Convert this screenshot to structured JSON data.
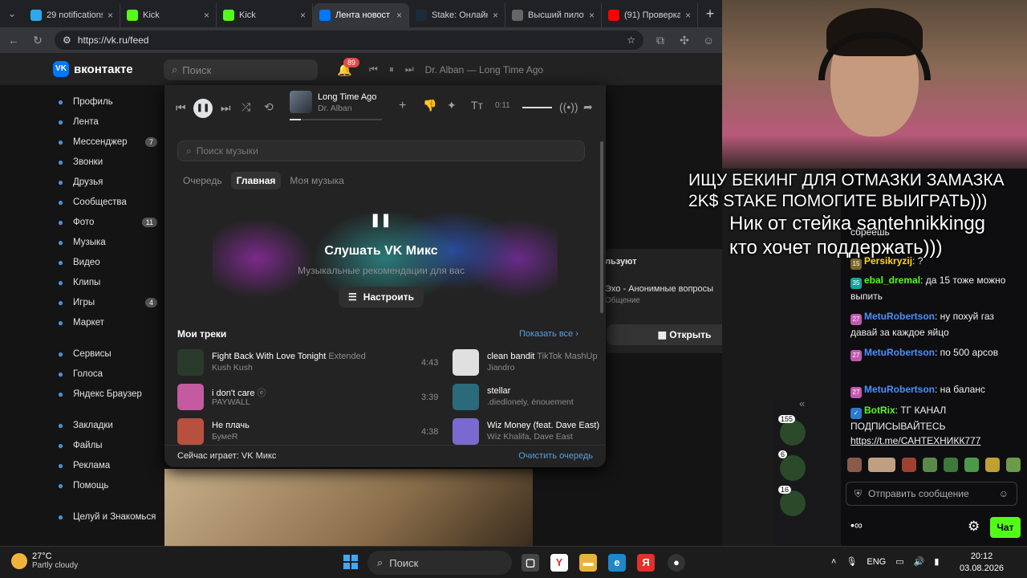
{
  "browser": {
    "tabs": [
      {
        "title": "29 notifications",
        "icon": "telegram-icon",
        "color": "#2aabee"
      },
      {
        "title": "Kick",
        "icon": "kick-icon",
        "color": "#53fc18"
      },
      {
        "title": "Kick",
        "icon": "kick-icon",
        "color": "#53fc18"
      },
      {
        "title": "Лента новост",
        "icon": "vk-video-icon",
        "color": "#0077ff"
      },
      {
        "title": "Stake: Онлайн-к",
        "icon": "stake-icon",
        "color": "#1a2c38"
      },
      {
        "title": "Высший пилота",
        "icon": "globe-icon",
        "color": "#666666"
      },
      {
        "title": "(91) Проверка",
        "icon": "youtube-icon",
        "color": "#ff0000"
      }
    ],
    "url": "https://vk.ru/feed"
  },
  "vk": {
    "brand": "вконтакте",
    "search_placeholder": "Поиск",
    "notifications_count": "89",
    "mini_player_track": "Dr. Alban — Long Time Ago",
    "sidebar": [
      {
        "label": "Профиль",
        "icon": "profile-icon",
        "badge": ""
      },
      {
        "label": "Лента",
        "icon": "feed-icon",
        "badge": ""
      },
      {
        "label": "Мессенджер",
        "icon": "messenger-icon",
        "badge": "7"
      },
      {
        "label": "Звонки",
        "icon": "phone-icon",
        "badge": ""
      },
      {
        "label": "Друзья",
        "icon": "friends-icon",
        "badge": ""
      },
      {
        "label": "Сообщества",
        "icon": "communities-icon",
        "badge": ""
      },
      {
        "label": "Фото",
        "icon": "photo-icon",
        "badge": "11"
      },
      {
        "label": "Музыка",
        "icon": "music-icon",
        "badge": ""
      },
      {
        "label": "Видео",
        "icon": "video-icon",
        "badge": ""
      },
      {
        "label": "Клипы",
        "icon": "clips-icon",
        "badge": ""
      },
      {
        "label": "Игры",
        "icon": "games-icon",
        "badge": "4"
      },
      {
        "label": "Маркет",
        "icon": "market-icon",
        "badge": ""
      }
    ],
    "sidebar2": [
      {
        "label": "Сервисы",
        "icon": "services-icon"
      },
      {
        "label": "Голоса",
        "icon": "votes-icon"
      },
      {
        "label": "Яндекс Браузер",
        "icon": "yandex-icon"
      }
    ],
    "sidebar3": [
      {
        "label": "Закладки",
        "icon": "bookmark-icon"
      },
      {
        "label": "Файлы",
        "icon": "files-icon"
      },
      {
        "label": "Реклама",
        "icon": "ads-icon"
      },
      {
        "label": "Помощь",
        "icon": "help-icon"
      }
    ],
    "sidebar4": [
      {
        "label": "Целуй и Знакомься",
        "icon": "app-icon"
      }
    ],
    "right_panel": {
      "heading": "льзуют",
      "app_name": "Эхо - Анонимные вопросы",
      "app_sub": "Общение",
      "open_label": "Открыть"
    }
  },
  "player": {
    "track_title": "Long Time Ago",
    "track_artist": "Dr. Alban",
    "time": "0:11",
    "progress": 0.12,
    "search_placeholder": "Поиск музыки",
    "tabs": [
      "Очередь",
      "Главная",
      "Моя музыка"
    ],
    "active_tab": 1,
    "mix_title": "Слушать VK Микс",
    "mix_subtitle": "Музыкальные рекомендации для вас",
    "tune_label": "Настроить",
    "my_tracks_title": "Мои треки",
    "show_all": "Показать все",
    "tracks_left": [
      {
        "title": "Fight Back With Love Tonight",
        "extra": "Extended",
        "artist": "Kush Kush",
        "duration": "4:43",
        "color": "#2a3a2a"
      },
      {
        "title": "i don't care",
        "extra": "ⓔ",
        "artist": "PAYWALL",
        "duration": "3:39",
        "color": "#c45aa0"
      },
      {
        "title": "Не плачь",
        "extra": "",
        "artist": "БумеR",
        "duration": "4:38",
        "color": "#b85040"
      }
    ],
    "tracks_right": [
      {
        "title": "clean bandit",
        "extra": "TikTok MashUp",
        "artist": "Jiandro",
        "color": "#e0e0e0"
      },
      {
        "title": "stellar",
        "extra": "",
        "artist": ".diedlonely, énouement",
        "color": "#2a6a7a"
      },
      {
        "title": "Wiz Money (feat. Dave East)",
        "extra": "",
        "artist": "Wiz Khalifa, Dave East",
        "color": "#7a6ad0"
      }
    ],
    "now_playing": "Сейчас играет: VK Микс",
    "clear_queue": "Очистить очередь"
  },
  "stream": {
    "overlay_lines": [
      "ИЩУ БЕКИНГ ДЛЯ ОТМАЗКИ ЗАМАЗКА",
      "2K$ STAKE ПОМОГИТЕ ВЫИГРАТЬ)))",
      "Ник от стейка santehnikkingg",
      "кто хочет поддержать)))"
    ],
    "chat": [
      {
        "badge": "",
        "user": "",
        "text": "сбреешь",
        "ucolor": "#efeff1",
        "bcolor": "#444"
      },
      {
        "badge": "15",
        "user": "Persikryzij",
        "text": "?",
        "ucolor": "#ffd700",
        "bcolor": "#7a6a2a"
      },
      {
        "badge": "35",
        "user": "ebal_dremal",
        "text": "да 15 тоже можно выпить",
        "ucolor": "#53fc18",
        "bcolor": "#1aa19a"
      },
      {
        "badge": "27",
        "user": "MetuRobertson",
        "text": "ну похуй газ давай за каждое яйцо",
        "ucolor": "#4a8fff",
        "bcolor": "#c05ab0"
      },
      {
        "badge": "27",
        "user": "MetuRobertson",
        "text": "по 500 арсов",
        "ucolor": "#4a8fff",
        "bcolor": "#c05ab0"
      },
      {
        "badge": "27",
        "user": "MetuRobertson",
        "text": "на баланс",
        "ucolor": "#4a8fff",
        "bcolor": "#c05ab0"
      },
      {
        "badge": "",
        "user": "BotRix",
        "text": "ТГ КАНАЛ ПОДПИСЫВАЙТЕСЬ",
        "ucolor": "#53fc18",
        "bcolor": "#2a7ad0"
      }
    ],
    "chat_link": "https://t.me/САНТЕХНИКК777",
    "send_placeholder": "Отправить сообщение",
    "chat_button": "Чат",
    "streams": [
      "155",
      "6",
      "16"
    ]
  },
  "taskbar": {
    "temp": "27°C",
    "weather": "Partly cloudy",
    "search": "Поиск",
    "lang": "ENG",
    "time": "20:12",
    "date": "03.08.2026"
  }
}
